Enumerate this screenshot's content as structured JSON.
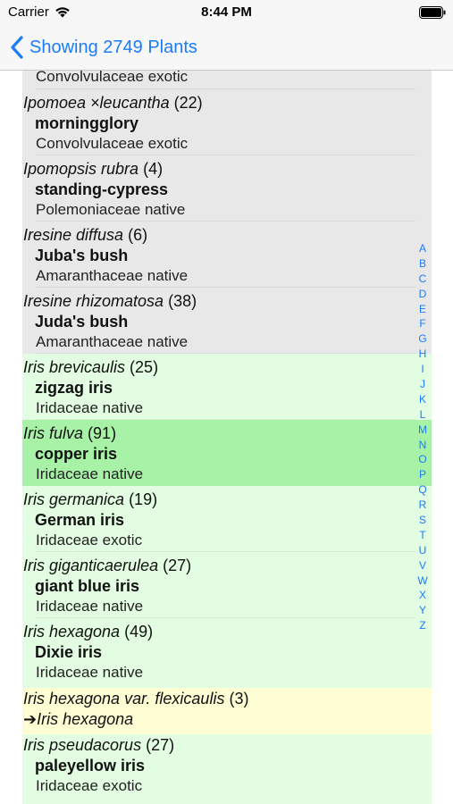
{
  "status": {
    "carrier": "Carrier",
    "time": "8:44 PM"
  },
  "nav": {
    "back_label": "Showing 2749 Plants"
  },
  "index_letters": [
    "A",
    "B",
    "C",
    "D",
    "E",
    "F",
    "G",
    "H",
    "I",
    "J",
    "K",
    "L",
    "M",
    "N",
    "O",
    "P",
    "Q",
    "R",
    "S",
    "T",
    "U",
    "V",
    "W",
    "X",
    "Y",
    "Z"
  ],
  "rows": [
    {
      "family": "Convolvulaceae",
      "status": "exotic",
      "highlight": "gray"
    },
    {
      "sci": "Ipomoea ×leucantha",
      "count": "(22)",
      "common": "morningglory",
      "family": "Convolvulaceae",
      "status": "exotic",
      "highlight": "gray"
    },
    {
      "sci": "Ipomopsis rubra",
      "count": "(4)",
      "common": "standing-cypress",
      "family": "Polemoniaceae",
      "status": "native",
      "highlight": "gray"
    },
    {
      "sci": "Iresine diffusa",
      "count": "(6)",
      "common": "Juba's bush",
      "family": "Amaranthaceae",
      "status": "native",
      "highlight": "gray"
    },
    {
      "sci": "Iresine rhizomatosa",
      "count": "(38)",
      "common": "Juda's bush",
      "family": "Amaranthaceae",
      "status": "native",
      "highlight": "gray"
    },
    {
      "sci": "Iris brevicaulis",
      "count": "(25)",
      "common": "zigzag iris",
      "family": "Iridaceae",
      "status": "native",
      "highlight": "green"
    },
    {
      "sci": "Iris fulva",
      "count": "(91)",
      "common": "copper iris",
      "family": "Iridaceae",
      "status": "native",
      "highlight": "selected"
    },
    {
      "sci": "Iris germanica",
      "count": "(19)",
      "common": "German iris",
      "family": "Iridaceae",
      "status": "exotic",
      "highlight": "green"
    },
    {
      "sci": "Iris giganticaerulea",
      "count": "(27)",
      "common": "giant blue iris",
      "family": "Iridaceae",
      "status": "native",
      "highlight": "green"
    },
    {
      "sci": "Iris hexagona",
      "count": "(49)",
      "common": "Dixie iris",
      "family": "Iridaceae",
      "status": "native",
      "highlight": "green"
    },
    {
      "sci": "Iris hexagona var. flexicaulis",
      "count": "(3)",
      "synonym_arrow": "➔",
      "synonym_of": "Iris hexagona",
      "highlight": "yellow"
    },
    {
      "sci": "Iris pseudacorus",
      "count": "(27)",
      "common": "paleyellow iris",
      "family": "Iridaceae",
      "status": "exotic",
      "highlight": "green"
    }
  ]
}
